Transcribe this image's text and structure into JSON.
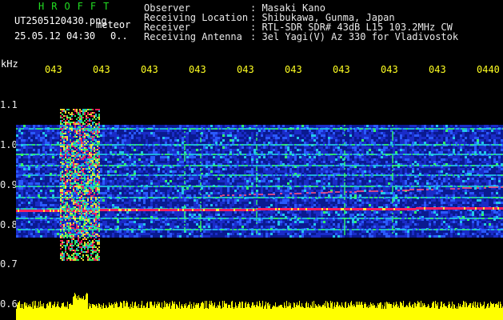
{
  "app": {
    "title": "HROFFT",
    "filename": "UT2505120430.png",
    "event_label": "meteor",
    "datetime": "25.05.12 04:30",
    "counter": "0.."
  },
  "header": {
    "rows": [
      {
        "key": "Observer",
        "value": ": Masaki Kano"
      },
      {
        "key": "Receiving Location",
        "value": ": Shibukawa, Gunma, Japan"
      },
      {
        "key": "Receiver",
        "value": ": RTL-SDR SDR# 43dB L15 103.2MHz CW"
      },
      {
        "key": "Receiving Antenna",
        "value": ": 3el Yagi(V) Az 330 for Vladivostok"
      }
    ]
  },
  "spectrogram": {
    "freq_unit": "kHz",
    "time_ticks": [
      "043",
      "043",
      "043",
      "043",
      "043",
      "043",
      "043",
      "043",
      "043",
      "0440"
    ],
    "freq_labels": [
      "1.1",
      "1.0",
      "0.9",
      "0.8",
      "0.7",
      "0.6"
    ],
    "colors": {
      "background": "#000000",
      "noise": "#1a2cc8",
      "signal": "#ff2060",
      "amplitude": "#ffff00",
      "text_header": "#e8e8e8",
      "text_title": "#22dd22",
      "text_ticks": "#ffff22"
    }
  }
}
